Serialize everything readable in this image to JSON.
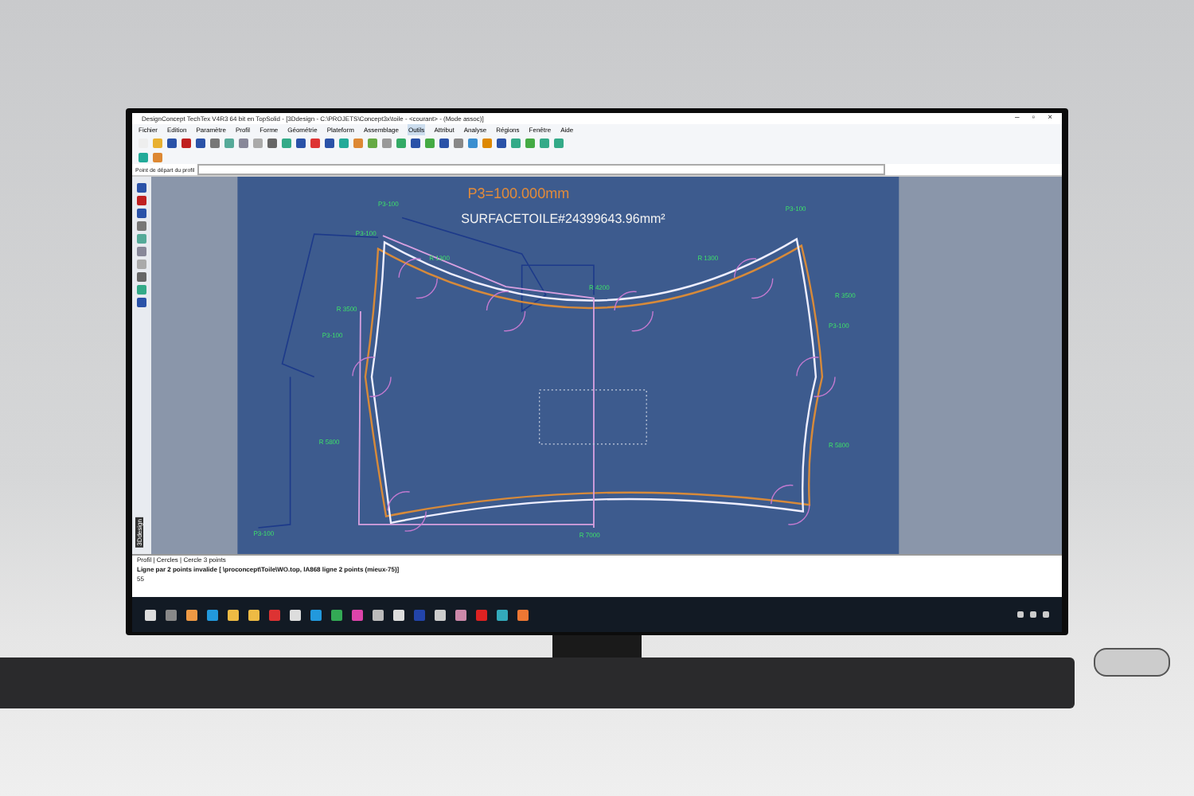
{
  "window": {
    "title": "DesignConcept TechTex V4R3 64 bit en TopSolid - [3Ddesign - C:\\PROJETS\\Concept3x\\toile - <courant> - (Mode assoc)]"
  },
  "window_buttons": [
    "–",
    "▫",
    "×"
  ],
  "menu": [
    {
      "label": "Fichier",
      "selected": false
    },
    {
      "label": "Edition",
      "selected": false
    },
    {
      "label": "Paramètre",
      "selected": false
    },
    {
      "label": "Profil",
      "selected": false
    },
    {
      "label": "Forme",
      "selected": false
    },
    {
      "label": "Géométrie",
      "selected": false
    },
    {
      "label": "Plateform",
      "selected": false
    },
    {
      "label": "Assemblage",
      "selected": false
    },
    {
      "label": "Outils",
      "selected": true
    },
    {
      "label": "Attribut",
      "selected": false
    },
    {
      "label": "Analyse",
      "selected": false
    },
    {
      "label": "Régions",
      "selected": false
    },
    {
      "label": "Fenêtre",
      "selected": false
    },
    {
      "label": "Aide",
      "selected": false
    }
  ],
  "prompt_field": {
    "label": "Point de départ du profil"
  },
  "canvas": {
    "dimension": "P3=100.000mm",
    "surface": "SURFACETOILE#24399643.96mm²",
    "labels": [
      "P3-100",
      "P3-100",
      "R 1300",
      "R 4200",
      "R 3500",
      "P3-100",
      "R 1300",
      "P3-100",
      "R 3500",
      "P3-100",
      "R 5800",
      "R 5800",
      "P3-100",
      "R 7000"
    ]
  },
  "side_tab": "3Ddesign",
  "command": {
    "breadcrumb": "Profil | Cercles | Cercle 3 points",
    "message": "Ligne par 2 points invalide [ \\proconcept\\Toile\\WO.top, lA868 ligne 2 points (mieux-75)]",
    "input": "55"
  }
}
